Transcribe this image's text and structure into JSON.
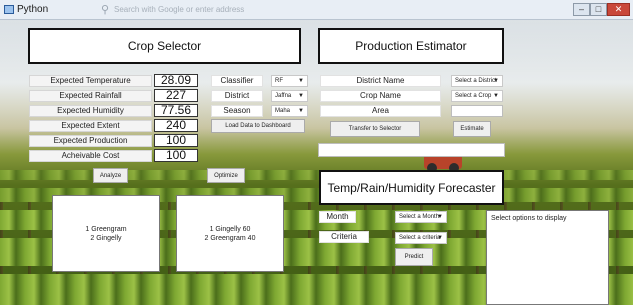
{
  "window": {
    "title": "Python",
    "search_placeholder": "Search with Google or enter address",
    "controls": {
      "minimize": "–",
      "maximize": "□",
      "close": "✕"
    }
  },
  "crop_selector": {
    "title": "Crop Selector",
    "fields": [
      {
        "label": "Expected Temperature",
        "value": "28.09"
      },
      {
        "label": "Expected Rainfall",
        "value": "227"
      },
      {
        "label": "Expected Humidity",
        "value": "77.56"
      },
      {
        "label": "Expected Extent",
        "value": "240"
      },
      {
        "label": "Expected Production",
        "value": "100"
      },
      {
        "label": "Acheivable Cost",
        "value": "100"
      }
    ],
    "options": [
      {
        "label": "Classifier",
        "value": "RF"
      },
      {
        "label": "District",
        "value": "Jaffna"
      },
      {
        "label": "Season",
        "value": "Maha"
      }
    ],
    "load_button": "Load Data to Dashboard",
    "analyze_button": "Analyze",
    "optimize_button": "Optimize",
    "analyze_result": [
      "1 Greengram",
      "2 Gingelly"
    ],
    "optimize_result": [
      "1 Gingelly 60",
      "2 Greengram 40"
    ]
  },
  "production_estimator": {
    "title": "Production Estimator",
    "rows": [
      {
        "label": "District Name",
        "value": "Select a District"
      },
      {
        "label": "Crop Name",
        "value": "Select a Crop"
      },
      {
        "label": "Area",
        "value": ""
      }
    ],
    "transfer_button": "Transfer to Selector",
    "estimate_button": "Estimate"
  },
  "forecaster": {
    "title": "Temp/Rain/Humidity Forecaster",
    "month_label": "Month",
    "month_value": "Select a Month",
    "criteria_label": "Criteria",
    "criteria_value": "Select a criteria",
    "predict_button": "Predict",
    "output_text": "Select options to display"
  }
}
